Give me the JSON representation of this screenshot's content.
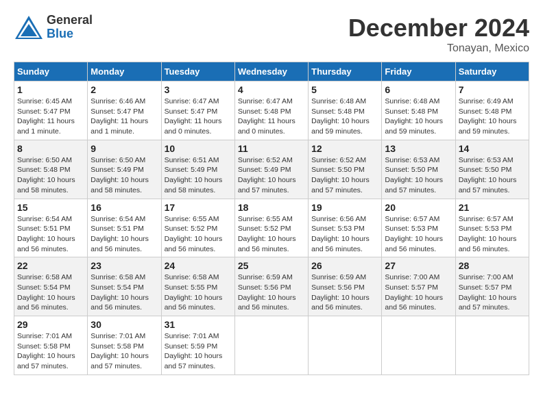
{
  "header": {
    "logo_general": "General",
    "logo_blue": "Blue",
    "month_title": "December 2024",
    "location": "Tonayan, Mexico"
  },
  "calendar": {
    "days_of_week": [
      "Sunday",
      "Monday",
      "Tuesday",
      "Wednesday",
      "Thursday",
      "Friday",
      "Saturday"
    ],
    "weeks": [
      [
        {
          "day": "1",
          "sunrise": "Sunrise: 6:45 AM",
          "sunset": "Sunset: 5:47 PM",
          "daylight": "Daylight: 11 hours and 1 minute."
        },
        {
          "day": "2",
          "sunrise": "Sunrise: 6:46 AM",
          "sunset": "Sunset: 5:47 PM",
          "daylight": "Daylight: 11 hours and 1 minute."
        },
        {
          "day": "3",
          "sunrise": "Sunrise: 6:47 AM",
          "sunset": "Sunset: 5:47 PM",
          "daylight": "Daylight: 11 hours and 0 minutes."
        },
        {
          "day": "4",
          "sunrise": "Sunrise: 6:47 AM",
          "sunset": "Sunset: 5:48 PM",
          "daylight": "Daylight: 11 hours and 0 minutes."
        },
        {
          "day": "5",
          "sunrise": "Sunrise: 6:48 AM",
          "sunset": "Sunset: 5:48 PM",
          "daylight": "Daylight: 10 hours and 59 minutes."
        },
        {
          "day": "6",
          "sunrise": "Sunrise: 6:48 AM",
          "sunset": "Sunset: 5:48 PM",
          "daylight": "Daylight: 10 hours and 59 minutes."
        },
        {
          "day": "7",
          "sunrise": "Sunrise: 6:49 AM",
          "sunset": "Sunset: 5:48 PM",
          "daylight": "Daylight: 10 hours and 59 minutes."
        }
      ],
      [
        {
          "day": "8",
          "sunrise": "Sunrise: 6:50 AM",
          "sunset": "Sunset: 5:48 PM",
          "daylight": "Daylight: 10 hours and 58 minutes."
        },
        {
          "day": "9",
          "sunrise": "Sunrise: 6:50 AM",
          "sunset": "Sunset: 5:49 PM",
          "daylight": "Daylight: 10 hours and 58 minutes."
        },
        {
          "day": "10",
          "sunrise": "Sunrise: 6:51 AM",
          "sunset": "Sunset: 5:49 PM",
          "daylight": "Daylight: 10 hours and 58 minutes."
        },
        {
          "day": "11",
          "sunrise": "Sunrise: 6:52 AM",
          "sunset": "Sunset: 5:49 PM",
          "daylight": "Daylight: 10 hours and 57 minutes."
        },
        {
          "day": "12",
          "sunrise": "Sunrise: 6:52 AM",
          "sunset": "Sunset: 5:50 PM",
          "daylight": "Daylight: 10 hours and 57 minutes."
        },
        {
          "day": "13",
          "sunrise": "Sunrise: 6:53 AM",
          "sunset": "Sunset: 5:50 PM",
          "daylight": "Daylight: 10 hours and 57 minutes."
        },
        {
          "day": "14",
          "sunrise": "Sunrise: 6:53 AM",
          "sunset": "Sunset: 5:50 PM",
          "daylight": "Daylight: 10 hours and 57 minutes."
        }
      ],
      [
        {
          "day": "15",
          "sunrise": "Sunrise: 6:54 AM",
          "sunset": "Sunset: 5:51 PM",
          "daylight": "Daylight: 10 hours and 56 minutes."
        },
        {
          "day": "16",
          "sunrise": "Sunrise: 6:54 AM",
          "sunset": "Sunset: 5:51 PM",
          "daylight": "Daylight: 10 hours and 56 minutes."
        },
        {
          "day": "17",
          "sunrise": "Sunrise: 6:55 AM",
          "sunset": "Sunset: 5:52 PM",
          "daylight": "Daylight: 10 hours and 56 minutes."
        },
        {
          "day": "18",
          "sunrise": "Sunrise: 6:55 AM",
          "sunset": "Sunset: 5:52 PM",
          "daylight": "Daylight: 10 hours and 56 minutes."
        },
        {
          "day": "19",
          "sunrise": "Sunrise: 6:56 AM",
          "sunset": "Sunset: 5:53 PM",
          "daylight": "Daylight: 10 hours and 56 minutes."
        },
        {
          "day": "20",
          "sunrise": "Sunrise: 6:57 AM",
          "sunset": "Sunset: 5:53 PM",
          "daylight": "Daylight: 10 hours and 56 minutes."
        },
        {
          "day": "21",
          "sunrise": "Sunrise: 6:57 AM",
          "sunset": "Sunset: 5:53 PM",
          "daylight": "Daylight: 10 hours and 56 minutes."
        }
      ],
      [
        {
          "day": "22",
          "sunrise": "Sunrise: 6:58 AM",
          "sunset": "Sunset: 5:54 PM",
          "daylight": "Daylight: 10 hours and 56 minutes."
        },
        {
          "day": "23",
          "sunrise": "Sunrise: 6:58 AM",
          "sunset": "Sunset: 5:54 PM",
          "daylight": "Daylight: 10 hours and 56 minutes."
        },
        {
          "day": "24",
          "sunrise": "Sunrise: 6:58 AM",
          "sunset": "Sunset: 5:55 PM",
          "daylight": "Daylight: 10 hours and 56 minutes."
        },
        {
          "day": "25",
          "sunrise": "Sunrise: 6:59 AM",
          "sunset": "Sunset: 5:56 PM",
          "daylight": "Daylight: 10 hours and 56 minutes."
        },
        {
          "day": "26",
          "sunrise": "Sunrise: 6:59 AM",
          "sunset": "Sunset: 5:56 PM",
          "daylight": "Daylight: 10 hours and 56 minutes."
        },
        {
          "day": "27",
          "sunrise": "Sunrise: 7:00 AM",
          "sunset": "Sunset: 5:57 PM",
          "daylight": "Daylight: 10 hours and 56 minutes."
        },
        {
          "day": "28",
          "sunrise": "Sunrise: 7:00 AM",
          "sunset": "Sunset: 5:57 PM",
          "daylight": "Daylight: 10 hours and 57 minutes."
        }
      ],
      [
        {
          "day": "29",
          "sunrise": "Sunrise: 7:01 AM",
          "sunset": "Sunset: 5:58 PM",
          "daylight": "Daylight: 10 hours and 57 minutes."
        },
        {
          "day": "30",
          "sunrise": "Sunrise: 7:01 AM",
          "sunset": "Sunset: 5:58 PM",
          "daylight": "Daylight: 10 hours and 57 minutes."
        },
        {
          "day": "31",
          "sunrise": "Sunrise: 7:01 AM",
          "sunset": "Sunset: 5:59 PM",
          "daylight": "Daylight: 10 hours and 57 minutes."
        },
        null,
        null,
        null,
        null
      ]
    ]
  }
}
